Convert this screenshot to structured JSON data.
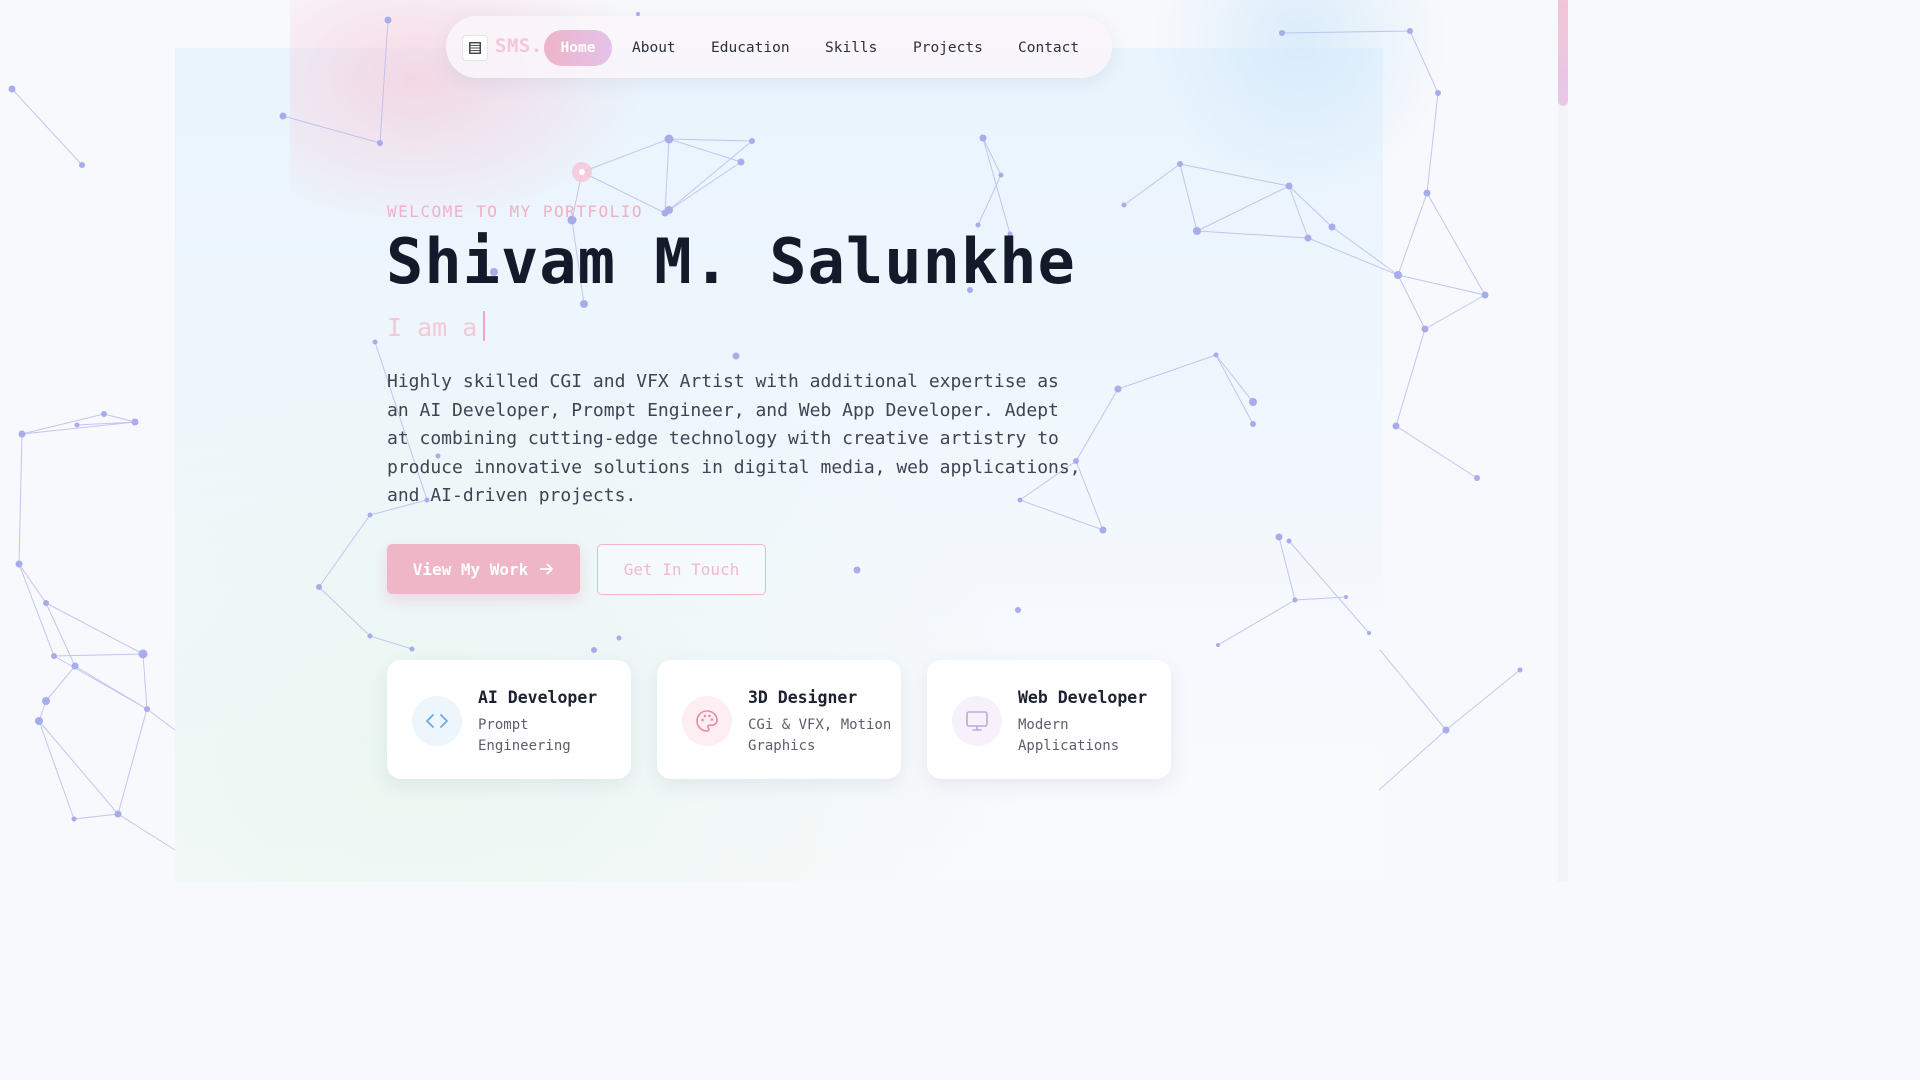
{
  "nav": {
    "logo_text": "SMS.",
    "logo_icon": "film-icon",
    "items": [
      {
        "label": "Home",
        "active": true
      },
      {
        "label": "About",
        "active": false
      },
      {
        "label": "Education",
        "active": false
      },
      {
        "label": "Skills",
        "active": false
      },
      {
        "label": "Projects",
        "active": false
      },
      {
        "label": "Contact",
        "active": false
      }
    ]
  },
  "hero": {
    "welcome": "WELCOME TO MY PORTFOLIO",
    "name": "Shivam M. Salunkhe",
    "typing_prefix": "I am a",
    "description": "Highly skilled CGI and VFX Artist with additional expertise as an AI Developer, Prompt Engineer, and Web App Developer. Adept at combining cutting-edge technology with creative artistry to produce innovative solutions in digital media, web applications, and AI-driven projects.",
    "primary_button": "View My Work",
    "secondary_button": "Get In Touch"
  },
  "cards": [
    {
      "title": "AI Developer",
      "subtitle": "Prompt Engineering",
      "icon": "code-icon",
      "icon_color": "#6aa9e4",
      "icon_bg": "#eef6fd"
    },
    {
      "title": "3D Designer",
      "subtitle": "CGi & VFX, Motion Graphics",
      "icon": "palette-icon",
      "icon_color": "#e98aa6",
      "icon_bg": "#fdeef2"
    },
    {
      "title": "Web Developer",
      "subtitle": "Modern Applications",
      "icon": "monitor-icon",
      "icon_color": "#c2a5d9",
      "icon_bg": "#f6f1fb"
    }
  ],
  "colors": {
    "accent_pink": "#efb6c7",
    "heading": "#141a2a",
    "network_dots": "#a7acea"
  }
}
